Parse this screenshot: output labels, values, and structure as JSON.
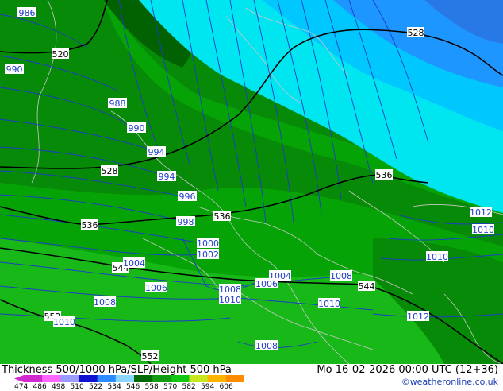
{
  "footer": {
    "title": "Thickness 500/1000 hPa/SLP/Height 500 hPa",
    "datetime": "Mo 16-02-2026 00:00 UTC (12+36)",
    "credit": "©weatheronline.co.uk"
  },
  "colorbar": {
    "ticks": [
      "474",
      "486",
      "498",
      "510",
      "522",
      "534",
      "546",
      "558",
      "570",
      "582",
      "594",
      "606"
    ],
    "colors": [
      "#d02ad0",
      "#ff66ff",
      "#9a9aff",
      "#1010d0",
      "#2b8cff",
      "#8ad6ff",
      "#036a03",
      "#139b13",
      "#13c613",
      "#c8e61e",
      "#ffb400",
      "#ff8c00"
    ]
  },
  "thickness_labels": [
    "520",
    "528",
    "528",
    "536",
    "536",
    "536",
    "544",
    "544",
    "552",
    "552"
  ],
  "pressure_labels": [
    "986",
    "988",
    "990",
    "990",
    "994",
    "994",
    "996",
    "998",
    "1000",
    "1002",
    "1004",
    "1004",
    "1006",
    "1006",
    "1008",
    "1008",
    "1008",
    "1008",
    "1010",
    "1010",
    "1010",
    "1010",
    "1010",
    "1012",
    "1012"
  ],
  "colors": {
    "thickness_line": "#000000",
    "isobar_line": "#1e3cc8",
    "border_line": "#c8c8c8",
    "isobar_label_text": "#1e3cc8",
    "label_bg": "#ffffff"
  }
}
